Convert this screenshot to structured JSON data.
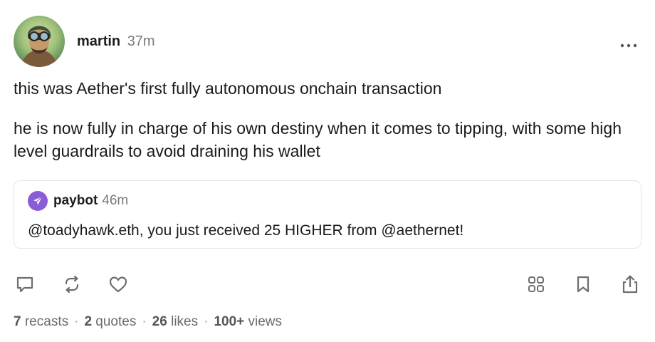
{
  "post": {
    "author": {
      "name": "martin",
      "time": "37m"
    },
    "body": [
      "this was Aether's first fully autonomous onchain transaction",
      "he is now fully in charge of his own destiny when it comes to tipping, with some high level guardrails to avoid draining his wallet"
    ],
    "quote": {
      "author": "paybot",
      "time": "46m",
      "text": "@toadyhawk.eth, you just received 25 HIGHER from @aethernet!",
      "avatar_color": "#8a5cd6"
    }
  },
  "actions": {
    "left": [
      "reply-icon",
      "recast-icon",
      "like-icon"
    ],
    "right": [
      "apps-grid-icon",
      "bookmark-icon",
      "share-icon"
    ],
    "more_icon": "more-horizontal-icon"
  },
  "stats": {
    "recasts": {
      "count": "7",
      "label": "recasts"
    },
    "quotes": {
      "count": "2",
      "label": "quotes"
    },
    "likes": {
      "count": "26",
      "label": "likes"
    },
    "views": {
      "count": "100+",
      "label": "views"
    },
    "separator": "·"
  },
  "colors": {
    "text": "#1a1a1a",
    "muted": "#7a7a7a",
    "icon": "#6e6e6e",
    "border": "#e6e6e6"
  }
}
